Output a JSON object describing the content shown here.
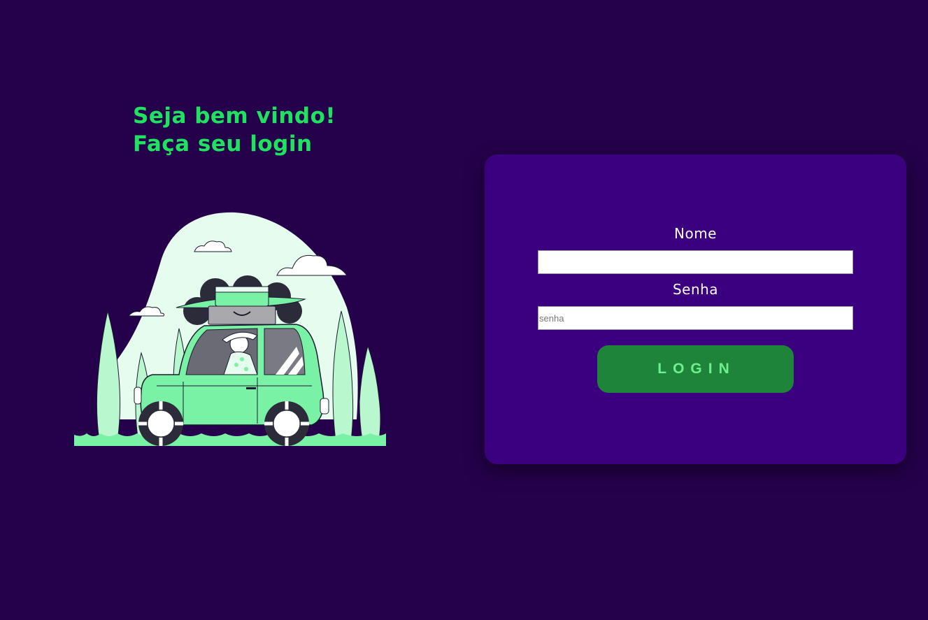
{
  "welcome": {
    "line1": "Seja bem vindo!",
    "line2": "Faça seu login"
  },
  "form": {
    "name_label": "Nome",
    "name_value": "",
    "name_placeholder": "",
    "password_label": "Senha",
    "password_value": "",
    "password_placeholder": "senha",
    "login_label": "LOGIN"
  },
  "colors": {
    "background": "#25004b",
    "card": "#3a0080",
    "accent_green": "#1fe35f",
    "button": "#1e8439",
    "button_text": "#6ff08e",
    "illustration_green": "#7af2a6",
    "illustration_light": "#e6fcef"
  },
  "icons": {
    "illustration": "travel-car-illustration"
  }
}
